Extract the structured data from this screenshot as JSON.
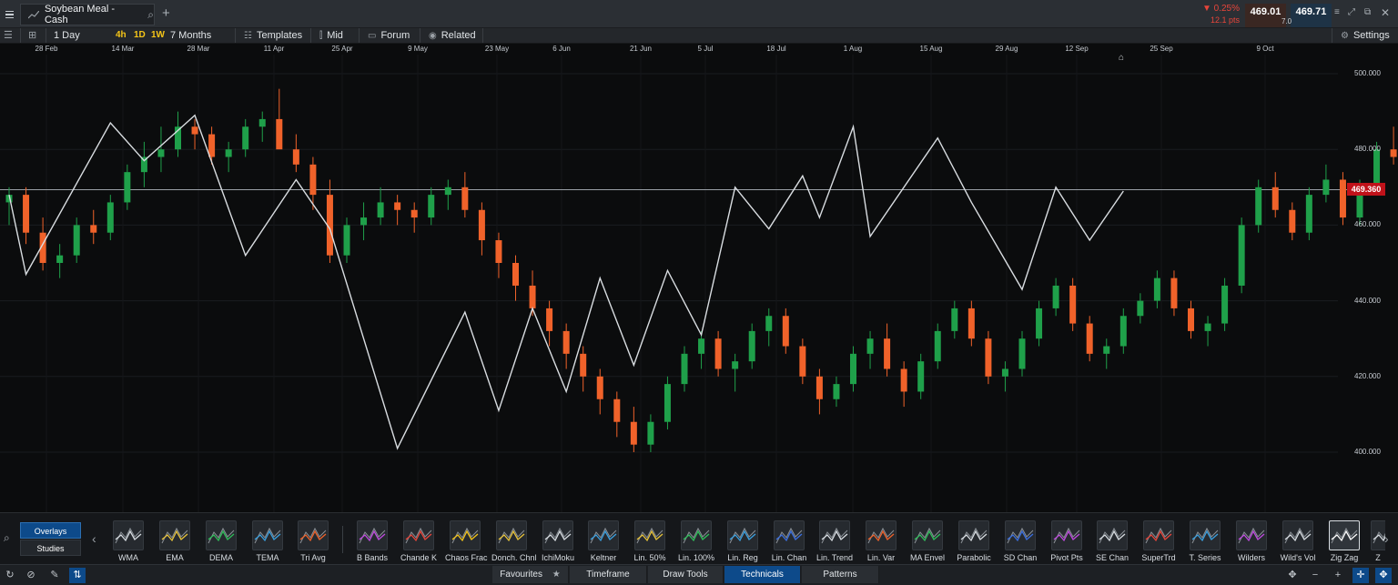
{
  "titlebar": {
    "instrument": "Soybean Meal - Cash",
    "change_pct": "▼ 0.25%",
    "change_pts": "12.1 pts",
    "bid": "469.01",
    "ask": "469.71",
    "spread": "7.0"
  },
  "toolbar": {
    "interval": "1 Day",
    "quick_intervals": [
      "4h",
      "1D",
      "1W"
    ],
    "range": "7 Months",
    "templates": "Templates",
    "mid": "Mid",
    "forum": "Forum",
    "related": "Related",
    "settings": "Settings"
  },
  "colors": {
    "up": "#1fa04a",
    "down": "#f0622a",
    "zigzag": "#d9dde1",
    "price_line": "#9aa0a6",
    "current_price_bg": "#c0121a",
    "accent": "#0d4a8a"
  },
  "chart_data": {
    "type": "candlestick",
    "instrument": "Soybean Meal - Cash",
    "x_labels": [
      "28 Feb",
      "14 Mar",
      "28 Mar",
      "11 Apr",
      "25 Apr",
      "9 May",
      "23 May",
      "6 Jun",
      "21 Jun",
      "5 Jul",
      "18 Jul",
      "1 Aug",
      "15 Aug",
      "29 Aug",
      "12 Sep",
      "25 Sep",
      "9 Oct"
    ],
    "y_ticks": [
      "500.000",
      "480.000",
      "460.000",
      "440.000",
      "420.000",
      "400.000"
    ],
    "ylim": [
      392,
      500
    ],
    "current_price": "469.360",
    "candles": [
      [
        466,
        470,
        460,
        468
      ],
      [
        468,
        470,
        455,
        458
      ],
      [
        458,
        462,
        448,
        450
      ],
      [
        450,
        455,
        446,
        452
      ],
      [
        452,
        462,
        450,
        460
      ],
      [
        460,
        464,
        455,
        458
      ],
      [
        458,
        468,
        456,
        466
      ],
      [
        466,
        476,
        464,
        474
      ],
      [
        474,
        482,
        470,
        478
      ],
      [
        478,
        486,
        474,
        480
      ],
      [
        480,
        490,
        478,
        486
      ],
      [
        486,
        488,
        480,
        484
      ],
      [
        484,
        486,
        476,
        478
      ],
      [
        478,
        482,
        474,
        480
      ],
      [
        480,
        488,
        478,
        486
      ],
      [
        486,
        490,
        482,
        488
      ],
      [
        488,
        496,
        484,
        480
      ],
      [
        480,
        484,
        474,
        476
      ],
      [
        476,
        478,
        464,
        468
      ],
      [
        468,
        472,
        450,
        452
      ],
      [
        452,
        462,
        450,
        460
      ],
      [
        460,
        466,
        456,
        462
      ],
      [
        462,
        470,
        460,
        466
      ],
      [
        466,
        468,
        460,
        464
      ],
      [
        464,
        466,
        458,
        462
      ],
      [
        462,
        470,
        460,
        468
      ],
      [
        468,
        472,
        464,
        470
      ],
      [
        470,
        474,
        462,
        464
      ],
      [
        464,
        466,
        452,
        456
      ],
      [
        456,
        458,
        446,
        450
      ],
      [
        450,
        452,
        440,
        444
      ],
      [
        444,
        448,
        436,
        438
      ],
      [
        438,
        440,
        428,
        432
      ],
      [
        432,
        434,
        422,
        426
      ],
      [
        426,
        428,
        416,
        420
      ],
      [
        420,
        422,
        410,
        414
      ],
      [
        414,
        416,
        404,
        408
      ],
      [
        408,
        412,
        400,
        402
      ],
      [
        402,
        410,
        400,
        408
      ],
      [
        408,
        420,
        406,
        418
      ],
      [
        418,
        428,
        416,
        426
      ],
      [
        426,
        432,
        422,
        430
      ],
      [
        430,
        432,
        420,
        422
      ],
      [
        422,
        426,
        416,
        424
      ],
      [
        424,
        434,
        422,
        432
      ],
      [
        432,
        438,
        428,
        436
      ],
      [
        436,
        438,
        426,
        428
      ],
      [
        428,
        430,
        418,
        420
      ],
      [
        420,
        422,
        410,
        414
      ],
      [
        414,
        420,
        412,
        418
      ],
      [
        418,
        428,
        416,
        426
      ],
      [
        426,
        432,
        422,
        430
      ],
      [
        430,
        434,
        420,
        422
      ],
      [
        422,
        424,
        412,
        416
      ],
      [
        416,
        426,
        414,
        424
      ],
      [
        424,
        434,
        422,
        432
      ],
      [
        432,
        440,
        430,
        438
      ],
      [
        438,
        440,
        428,
        430
      ],
      [
        430,
        432,
        418,
        420
      ],
      [
        420,
        424,
        416,
        422
      ],
      [
        422,
        432,
        420,
        430
      ],
      [
        430,
        440,
        428,
        438
      ],
      [
        438,
        446,
        436,
        444
      ],
      [
        444,
        446,
        432,
        434
      ],
      [
        434,
        436,
        424,
        426
      ],
      [
        426,
        430,
        422,
        428
      ],
      [
        428,
        438,
        426,
        436
      ],
      [
        436,
        442,
        434,
        440
      ],
      [
        440,
        448,
        438,
        446
      ],
      [
        446,
        448,
        436,
        438
      ],
      [
        438,
        440,
        430,
        432
      ],
      [
        432,
        436,
        428,
        434
      ],
      [
        434,
        446,
        432,
        444
      ],
      [
        444,
        462,
        442,
        460
      ],
      [
        460,
        472,
        458,
        470
      ],
      [
        470,
        474,
        462,
        464
      ],
      [
        464,
        466,
        456,
        458
      ],
      [
        458,
        470,
        456,
        468
      ],
      [
        468,
        476,
        466,
        472
      ],
      [
        472,
        474,
        460,
        462
      ],
      [
        462,
        472,
        460,
        470
      ],
      [
        470,
        482,
        468,
        480
      ],
      [
        480,
        486,
        476,
        478
      ],
      [
        478,
        480,
        466,
        468
      ],
      [
        468,
        470,
        454,
        458
      ],
      [
        458,
        466,
        456,
        464
      ],
      [
        464,
        474,
        462,
        472
      ],
      [
        472,
        482,
        470,
        480
      ],
      [
        480,
        486,
        474,
        476
      ],
      [
        476,
        478,
        464,
        466
      ],
      [
        466,
        468,
        456,
        462
      ],
      [
        462,
        466,
        458,
        464
      ],
      [
        464,
        466,
        446,
        448
      ],
      [
        448,
        452,
        440,
        444
      ],
      [
        444,
        450,
        442,
        448
      ],
      [
        448,
        468,
        446,
        466
      ],
      [
        466,
        470,
        460,
        464
      ],
      [
        464,
        466,
        456,
        460
      ],
      [
        460,
        462,
        454,
        456
      ],
      [
        456,
        466,
        454,
        464
      ],
      [
        464,
        472,
        462,
        470
      ],
      [
        470,
        472,
        464,
        469.4
      ]
    ],
    "zigzag": [
      [
        0,
        468
      ],
      [
        1,
        447
      ],
      [
        6,
        487
      ],
      [
        8,
        477
      ],
      [
        11,
        489
      ],
      [
        14,
        452
      ],
      [
        17,
        472
      ],
      [
        19,
        459
      ],
      [
        23,
        401
      ],
      [
        27,
        437
      ],
      [
        29,
        411
      ],
      [
        31,
        438
      ],
      [
        33,
        416
      ],
      [
        35,
        446
      ],
      [
        37,
        423
      ],
      [
        39,
        448
      ],
      [
        41,
        431
      ],
      [
        43,
        470
      ],
      [
        45,
        459
      ],
      [
        47,
        473
      ],
      [
        48,
        462
      ],
      [
        50,
        486
      ],
      [
        51,
        457
      ],
      [
        55,
        483
      ],
      [
        57,
        466
      ],
      [
        60,
        443
      ],
      [
        62,
        470
      ],
      [
        64,
        456
      ],
      [
        66,
        469
      ]
    ]
  },
  "strip": {
    "tabs": [
      "Overlays",
      "Studies"
    ],
    "indicators": [
      "WMA",
      "EMA",
      "DEMA",
      "TEMA",
      "Tri Avg",
      "B Bands",
      "Chande K",
      "Chaos Frac",
      "Donch. Chnl",
      "IchiMoku",
      "Keltner",
      "Lin. 50%",
      "Lin. 100%",
      "Lin. Reg",
      "Lin. Chan",
      "Lin. Trend",
      "Lin. Var",
      "MA Envel",
      "Parabolic",
      "SD Chan",
      "Pivot Pts",
      "SE Chan",
      "SuperTrd",
      "T. Series",
      "Wilders",
      "Wild's Vol",
      "Zig Zag",
      "Z"
    ]
  },
  "bottom_tabs": [
    "Favourites",
    "Timeframe",
    "Draw Tools",
    "Technicals",
    "Patterns"
  ]
}
